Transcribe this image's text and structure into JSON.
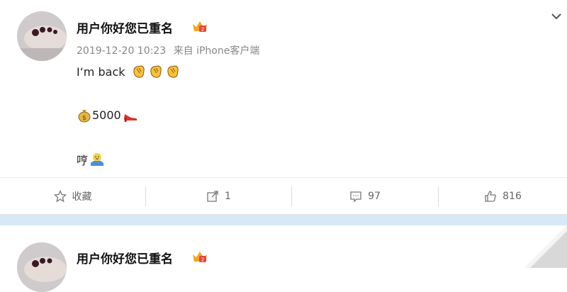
{
  "post": {
    "username": "用户你好您已重名",
    "timestamp": "2019-12-20 10:23",
    "source_prefix": "来自",
    "source": "iPhone客户端",
    "line1_text": "I‘m back",
    "line2_text": "5000",
    "line3_text": "哼",
    "emojis": {
      "line1": [
        "clap-emoji",
        "clap-emoji",
        "clap-emoji"
      ],
      "line2_before": "money-bag-emoji",
      "line2_after": "high-heel-emoji",
      "line3": "shrug-emoji"
    },
    "crown_icon": "vip-crown-icon"
  },
  "actions": {
    "favorite_label": "收藏",
    "repost_count": "1",
    "comment_count": "97",
    "like_count": "816"
  },
  "next_post": {
    "username": "用户你好您已重名",
    "crown_icon": "vip-crown-icon"
  },
  "colors": {
    "band": "#d7e9f7",
    "crown": "#f5a623",
    "muted_text": "#888888",
    "action_text": "#666666"
  }
}
